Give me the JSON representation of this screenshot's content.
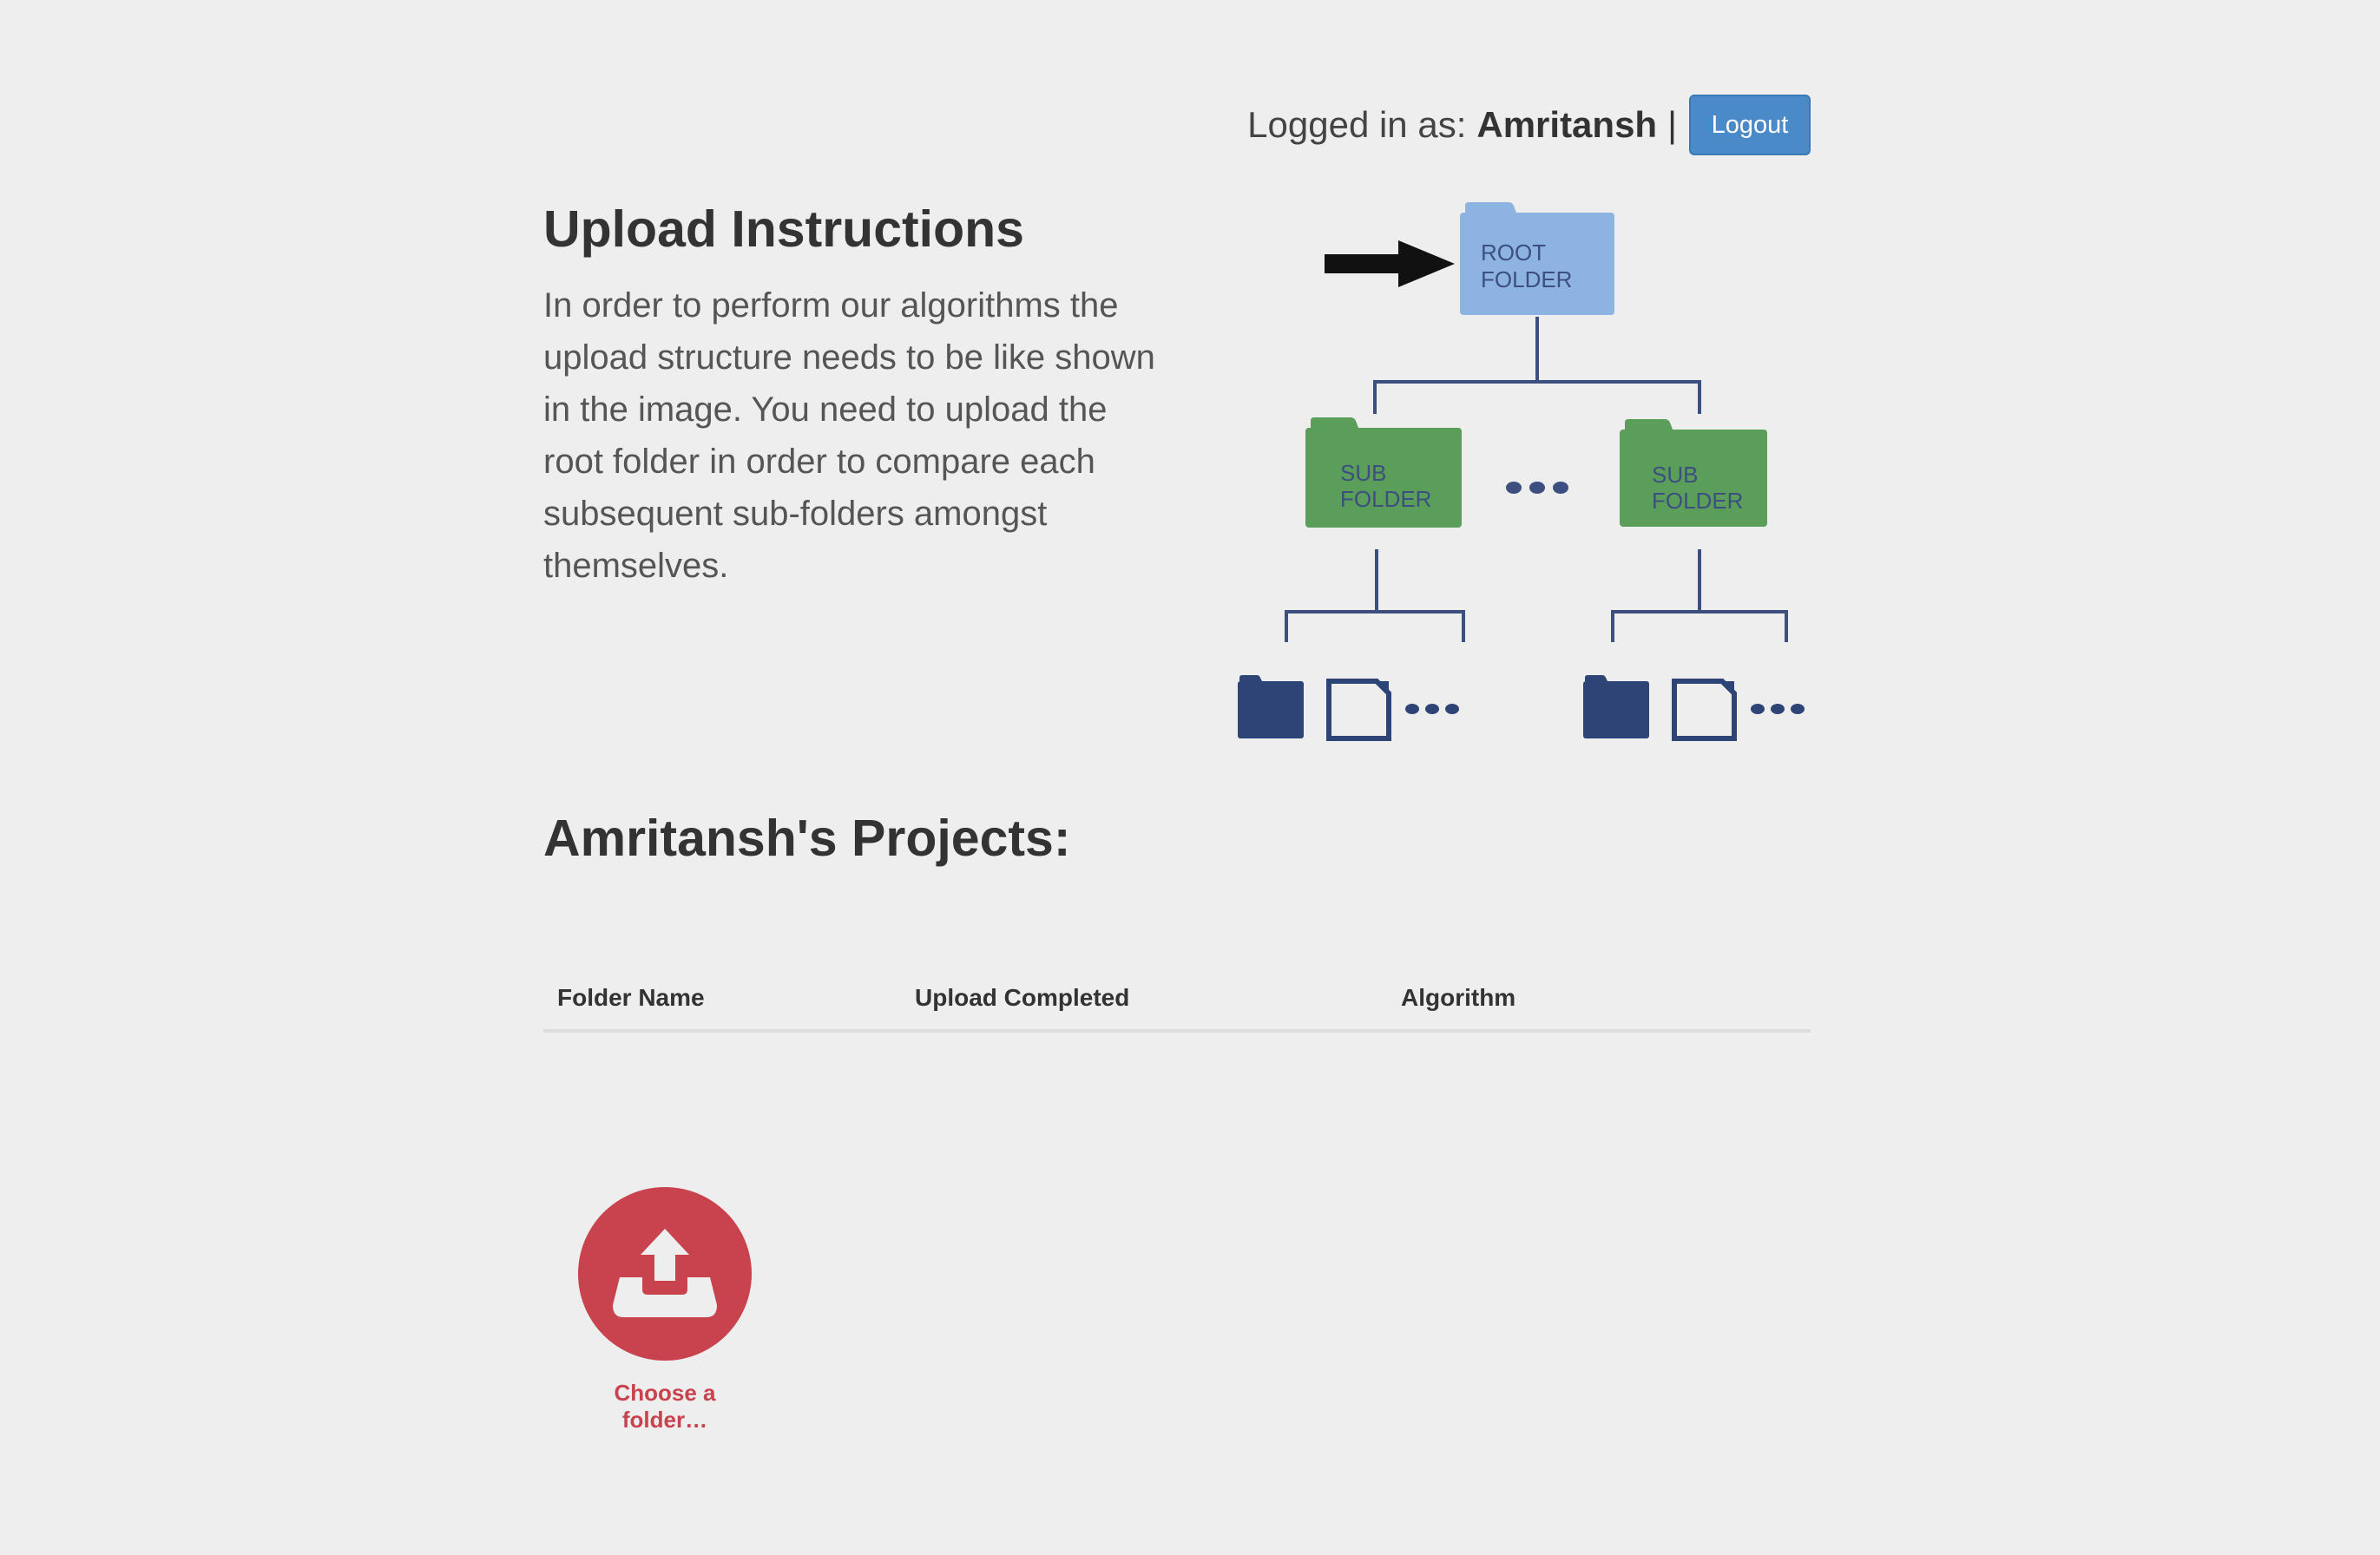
{
  "header": {
    "logged_in_label": "Logged in as:",
    "username": "Amritansh",
    "separator": "|",
    "logout_label": "Logout"
  },
  "instructions": {
    "title": "Upload Instructions",
    "text": "In order to perform our algorithms the upload structure needs to be like shown in the image. You need to upload the root folder in order to compare each subsequent sub-folders amongst themselves."
  },
  "diagram": {
    "root_folder_line1": "ROOT",
    "root_folder_line2": "FOLDER",
    "sub_folder_line1": "SUB",
    "sub_folder_line2": "FOLDER",
    "colors": {
      "root": "#8db3e2",
      "sub": "#5a9e5a",
      "line": "#3c4f80",
      "leaf": "#2e4476"
    }
  },
  "projects": {
    "title": "Amritansh's Projects:",
    "columns": [
      "Folder Name",
      "Upload Completed",
      "Algorithm"
    ],
    "rows": []
  },
  "upload": {
    "label": "Choose a folder…",
    "icon": "upload-tray-icon",
    "color": "#c9434f"
  }
}
